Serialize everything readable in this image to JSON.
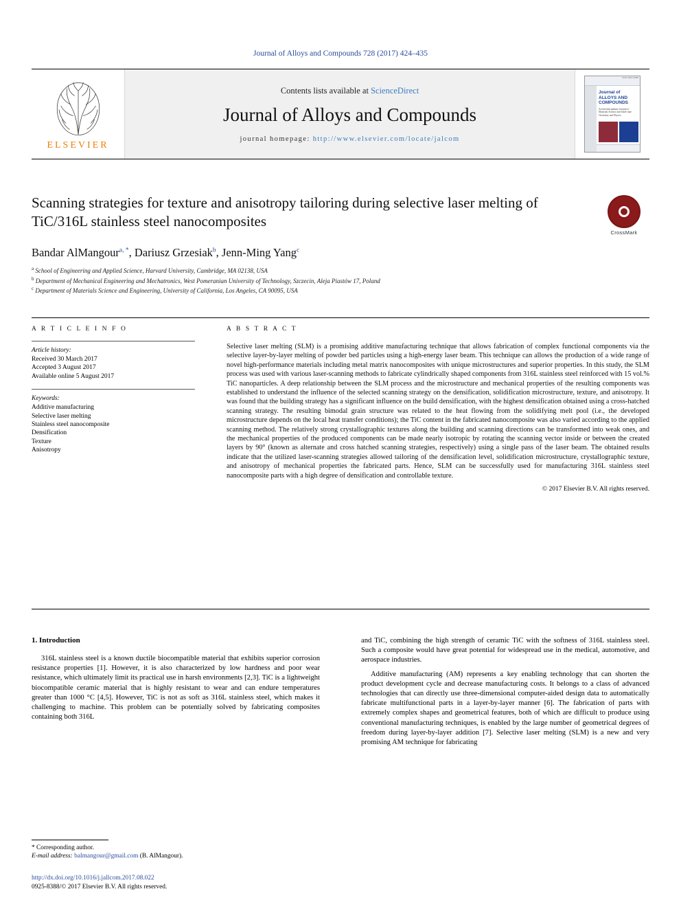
{
  "running_head": "Journal of Alloys and Compounds 728 (2017) 424–435",
  "masthead": {
    "contents_prefix": "Contents lists available at ",
    "sciencedirect": "ScienceDirect",
    "journal_title": "Journal of Alloys and Compounds",
    "homepage_prefix": "journal homepage: ",
    "homepage_url": "http://www.elsevier.com/locate/jalcom",
    "publisher": "ELSEVIER",
    "cover": {
      "top_note": "ISSN 0925-8388",
      "title": "Journal of ALLOYS AND COMPOUNDS",
      "subtitle": "An Interdisciplinary Journal of Materials Science and Solid-state Chemistry and Physics"
    }
  },
  "article": {
    "title": "Scanning strategies for texture and anisotropy tailoring during selective laser melting of TiC/316L stainless steel nanocomposites",
    "authors": [
      {
        "name": "Bandar AlMangour",
        "marks": "a, *"
      },
      {
        "name": "Dariusz Grzesiak",
        "marks": "b"
      },
      {
        "name": "Jenn-Ming Yang",
        "marks": "c"
      }
    ],
    "affiliations": [
      {
        "mark": "a",
        "text": "School of Engineering and Applied Science, Harvard University, Cambridge, MA 02138, USA"
      },
      {
        "mark": "b",
        "text": "Department of Mechanical Engineering and Mechatronics, West Pomeranian University of Technology, Szczecin, Aleja Piastów 17, Poland"
      },
      {
        "mark": "c",
        "text": "Department of Materials Science and Engineering, University of California, Los Angeles, CA 90095, USA"
      }
    ],
    "crossmark_label": "CrossMark"
  },
  "article_info": {
    "heading": "A R T I C L E   I N F O",
    "history_label": "Article history:",
    "history": [
      "Received 30 March 2017",
      "Accepted 3 August 2017",
      "Available online 5 August 2017"
    ],
    "keywords_label": "Keywords:",
    "keywords": [
      "Additive manufacturing",
      "Selective laser melting",
      "Stainless steel nanocomposite",
      "Densification",
      "Texture",
      "Anisotropy"
    ]
  },
  "abstract": {
    "heading": "A B S T R A C T",
    "text": "Selective laser melting (SLM) is a promising additive manufacturing technique that allows fabrication of complex functional components via the selective layer-by-layer melting of powder bed particles using a high-energy laser beam. This technique can allows the production of a wide range of novel high-performance materials including metal matrix nanocomposites with unique microstructures and superior properties. In this study, the SLM process was used with various laser-scanning methods to fabricate cylindrically shaped components from 316L stainless steel reinforced with 15 vol.% TiC nanoparticles. A deep relationship between the SLM process and the microstructure and mechanical properties of the resulting components was established to understand the influence of the selected scanning strategy on the densification, solidification microstructure, texture, and anisotropy. It was found that the building strategy has a significant influence on the build densification, with the highest densification obtained using a cross-hatched scanning strategy. The resulting bimodal grain structure was related to the heat flowing from the solidifying melt pool (i.e., the developed microstructure depends on the local heat transfer conditions); the TiC content in the fabricated nanocomposite was also varied according to the applied scanning method. The relatively strong crystallographic textures along the building and scanning directions can be transformed into weak ones, and the mechanical properties of the produced components can be made nearly isotropic by rotating the scanning vector inside or between the created layers by 90° (known as alternate and cross hatched scanning strategies, respectively) using a single pass of the laser beam. The obtained results indicate that the utilized laser-scanning strategies allowed tailoring of the densification level, solidification microstructure, crystallographic texture, and anisotropy of mechanical properties the fabricated parts. Hence, SLM can be successfully used for manufacturing 316L stainless steel nanocomposite parts with a high degree of densification and controllable texture.",
    "copyright": "© 2017 Elsevier B.V. All rights reserved."
  },
  "body": {
    "section_heading": "1.  Introduction",
    "left_paragraphs": [
      "316L stainless steel is a known ductile biocompatible material that exhibits superior corrosion resistance properties [1]. However, it is also characterized by low hardness and poor wear resistance, which ultimately limit its practical use in harsh environments [2,3]. TiC is a lightweight biocompatible ceramic material that is highly resistant to wear and can endure temperatures greater than 1000 °C [4,5]. However, TiC is not as soft as 316L stainless steel, which makes it challenging to machine. This problem can be potentially solved by fabricating composites containing both 316L"
    ],
    "right_paragraphs": [
      "and TiC, combining the high strength of ceramic TiC with the softness of 316L stainless steel. Such a composite would have great potential for widespread use in the medical, automotive, and aerospace industries.",
      "Additive manufacturing (AM) represents a key enabling technology that can shorten the product development cycle and decrease manufacturing costs. It belongs to a class of advanced technologies that can directly use three-dimensional computer-aided design data to automatically fabricate multifunctional parts in a layer-by-layer manner [6]. The fabrication of parts with extremely complex shapes and geometrical features, both of which are difficult to produce using conventional manufacturing techniques, is enabled by the large number of geometrical degrees of freedom during layer-by-layer addition [7]. Selective laser melting (SLM) is a new and very promising AM technique for fabricating"
    ]
  },
  "footnote": {
    "corresponding": "* Corresponding author.",
    "email_label": "E-mail address: ",
    "email": "balmangour@gmail.com",
    "email_suffix": " (B. AlMangour)."
  },
  "doi_block": {
    "doi": "http://dx.doi.org/10.1016/j.jallcom.2017.08.022",
    "issn_line": "0925-8388/© 2017 Elsevier B.V. All rights reserved."
  }
}
